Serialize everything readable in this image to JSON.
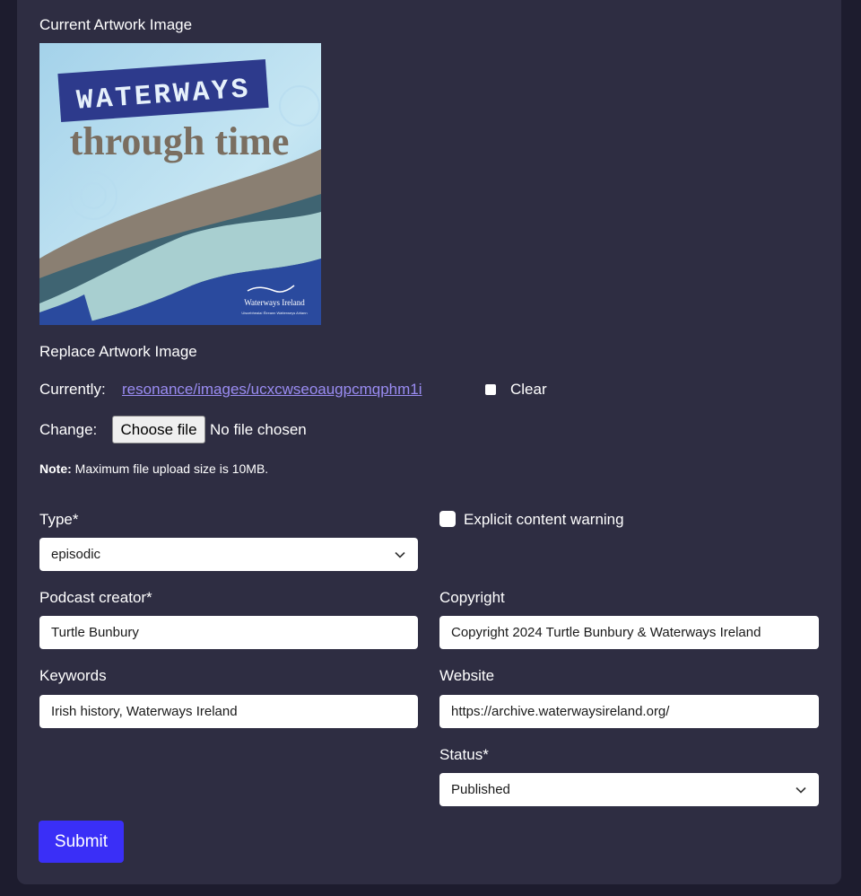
{
  "artwork": {
    "current_label": "Current Artwork Image",
    "title_line1": "WATERWAYS",
    "title_line2": "through time",
    "logo_text": "Waterways Ireland",
    "logo_subtext": "Uiscebhealaí Éireann   Watterweys Airlann"
  },
  "replace": {
    "label": "Replace Artwork Image",
    "currently_label": "Currently:",
    "currently_link": "resonance/images/ucxcwseoaugpcmqphm1i",
    "clear_label": "Clear",
    "change_label": "Change:",
    "choose_file_button": "Choose file",
    "file_status": "No file chosen",
    "note_bold": "Note:",
    "note_text": " Maximum file upload size is 10MB."
  },
  "form": {
    "type_label": "Type*",
    "type_value": "episodic",
    "explicit_label": "Explicit content warning",
    "explicit_checked": false,
    "creator_label": "Podcast creator*",
    "creator_value": "Turtle Bunbury",
    "copyright_label": "Copyright",
    "copyright_value": "Copyright 2024 Turtle Bunbury & Waterways Ireland",
    "keywords_label": "Keywords",
    "keywords_value": "Irish history, Waterways Ireland",
    "website_label": "Website",
    "website_value": "https://archive.waterwaysireland.org/",
    "status_label": "Status*",
    "status_value": "Published",
    "submit_label": "Submit"
  },
  "colors": {
    "page_background": "#1d1c2e",
    "card_background": "#2e2d42",
    "link": "#9a8cf2",
    "submit_button": "#3a2ff7"
  }
}
